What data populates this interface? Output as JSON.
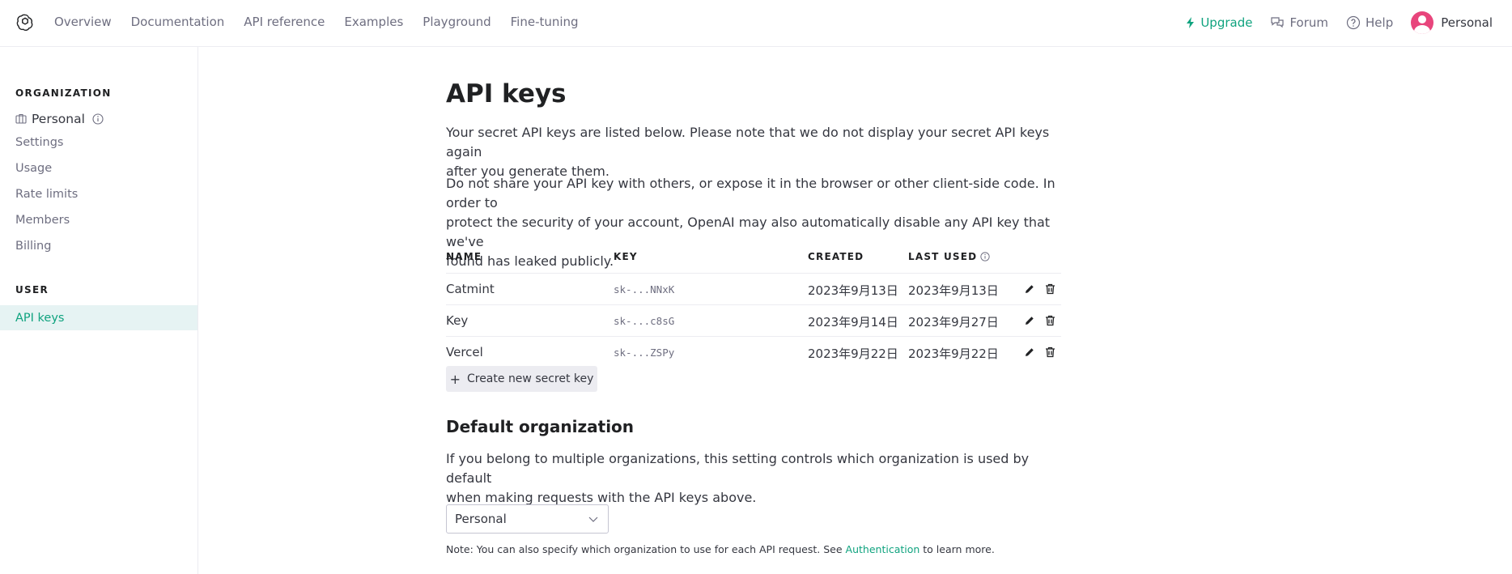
{
  "nav": {
    "links": [
      "Overview",
      "Documentation",
      "API reference",
      "Examples",
      "Playground",
      "Fine-tuning"
    ],
    "upgrade": "Upgrade",
    "forum": "Forum",
    "help": "Help",
    "personal": "Personal"
  },
  "sidebar": {
    "org_title": "ORGANIZATION",
    "org_name": "Personal",
    "items": [
      "Settings",
      "Usage",
      "Rate limits",
      "Members",
      "Billing"
    ],
    "user_title": "USER",
    "user_items": [
      "API keys"
    ]
  },
  "main": {
    "title": "API keys",
    "intro_line1": "Your secret API keys are listed below. Please note that we do not display your secret API keys again",
    "intro_line2": "after you generate them.",
    "warn_line1": "Do not share your API key with others, or expose it in the browser or other client-side code. In order to",
    "warn_line2": "protect the security of your account, OpenAI may also automatically disable any API key that we've",
    "warn_line3": "found has leaked publicly.",
    "table": {
      "headers": [
        "NAME",
        "KEY",
        "CREATED",
        "LAST USED"
      ],
      "rows": [
        {
          "name": "Catmint",
          "key": "sk-...NNxK",
          "created": "2023年9月13日",
          "last_used": "2023年9月13日"
        },
        {
          "name": "Key",
          "key": "sk-...c8sG",
          "created": "2023年9月14日",
          "last_used": "2023年9月27日"
        },
        {
          "name": "Vercel",
          "key": "sk-...ZSPy",
          "created": "2023年9月22日",
          "last_used": "2023年9月22日"
        }
      ]
    },
    "create_button": "Create new secret key",
    "default_org_title": "Default organization",
    "default_org_line1": "If you belong to multiple organizations, this setting controls which organization is used by default",
    "default_org_line2": "when making requests with the API keys above.",
    "org_select_value": "Personal",
    "note_prefix": "Note: You can also specify which organization to use for each API request. See",
    "note_link": "Authentication",
    "note_suffix": "to learn more."
  },
  "colors": {
    "accent": "#10a37f",
    "active_bg": "#e6f3f3",
    "avatar": "#e8457c"
  }
}
